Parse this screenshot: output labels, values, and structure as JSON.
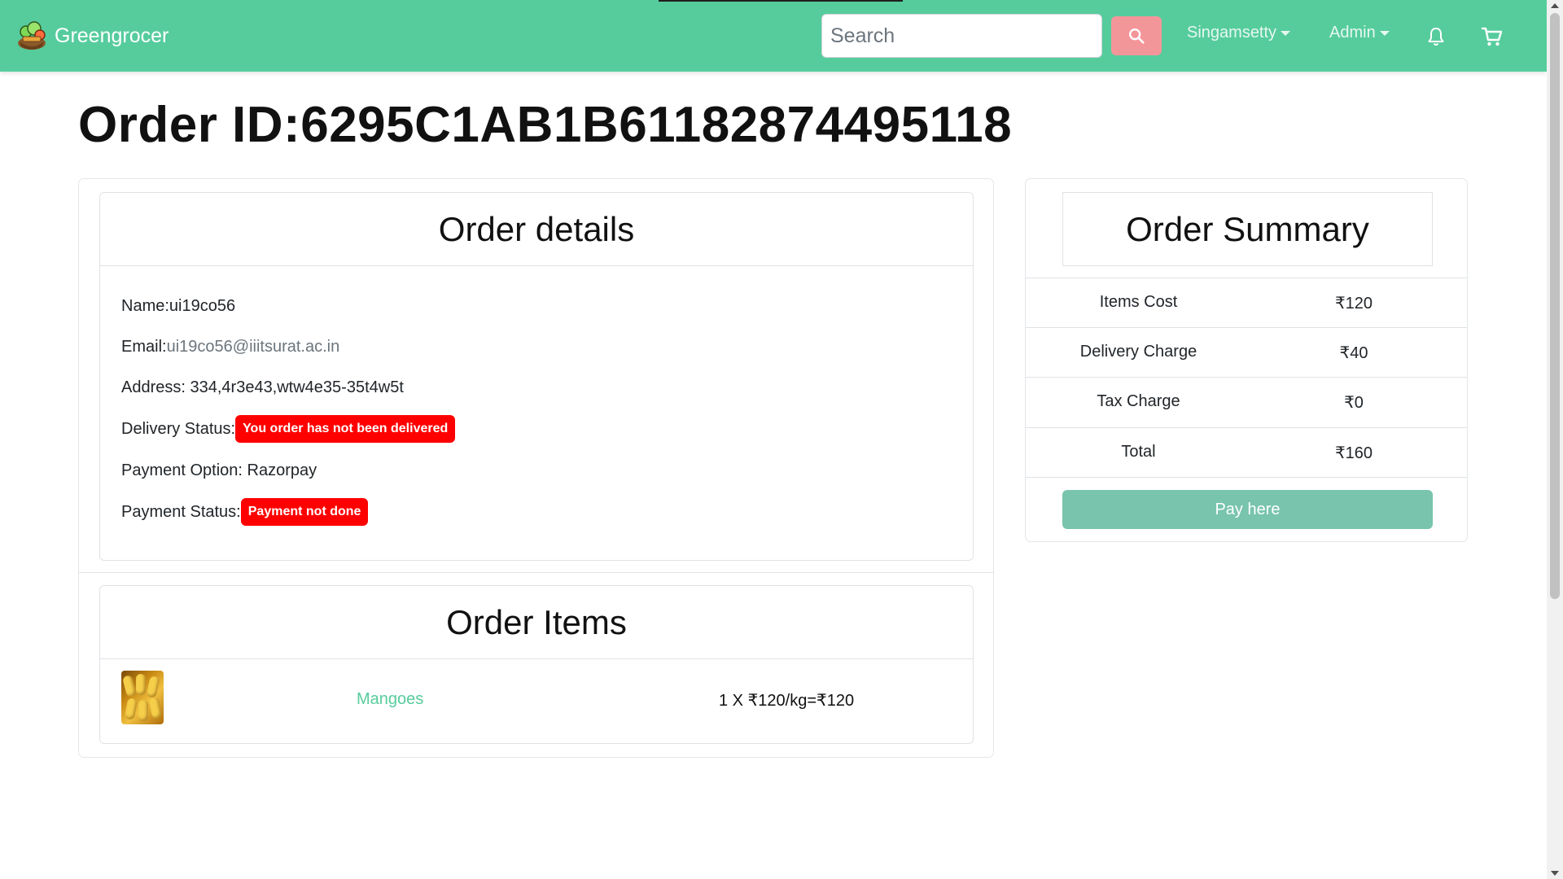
{
  "navbar": {
    "brand": "Greengrocer",
    "search_placeholder": "Search",
    "search_value": "",
    "user_menu": "Singamsetty",
    "admin_menu": "Admin",
    "icons": [
      "logo-icon",
      "search-icon",
      "bell-icon",
      "cart-icon"
    ],
    "colors": {
      "navbar_bg": "#56cc9d",
      "search_button_bg": "#f3969a"
    }
  },
  "page": {
    "title": "Order ID:6295C1AB1B61182874495118"
  },
  "order_details": {
    "heading": "Order details",
    "name_label": "Name:",
    "name_value": "ui19co56",
    "email_label": "Email:",
    "email_value": "ui19co56@iiitsurat.ac.in",
    "address_label": "Address: ",
    "address_value": "334,4r3e43,wtw4e35-35t4w5t",
    "delivery_status_label": "Delivery Status:",
    "delivery_status_badge": "You order has not been delivered",
    "payment_option_label": "Payment Option: ",
    "payment_option_value": "Razorpay",
    "payment_status_label": "Payment Status:",
    "payment_status_badge": "Payment not done",
    "badge_color": "#ff0000"
  },
  "order_items": {
    "heading": "Order Items",
    "items": [
      {
        "name": "Mangoes",
        "price_line": "1 X ₹120/kg=₹120"
      }
    ]
  },
  "summary": {
    "heading": "Order Summary",
    "rows": [
      {
        "label": "Items Cost",
        "value": "₹120"
      },
      {
        "label": "Delivery Charge",
        "value": "₹40"
      },
      {
        "label": "Tax Charge",
        "value": "₹0"
      },
      {
        "label": "Total",
        "value": "₹160"
      }
    ],
    "pay_button": "Pay here",
    "pay_button_color": "#78c4ac"
  }
}
